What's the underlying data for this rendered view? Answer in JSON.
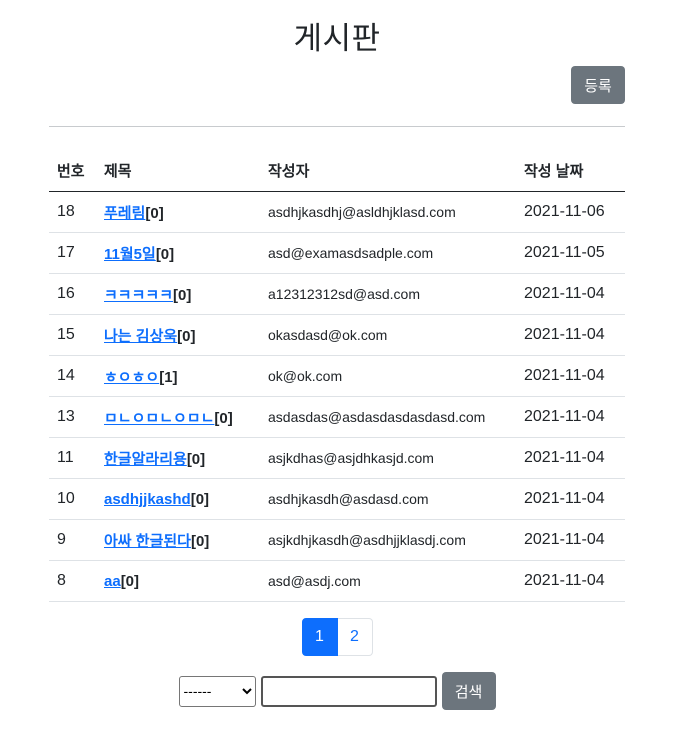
{
  "header": {
    "title": "게시판",
    "register_label": "등록"
  },
  "table": {
    "headers": {
      "no": "번호",
      "title": "제목",
      "author": "작성자",
      "date": "작성 날짜"
    },
    "rows": [
      {
        "no": "18",
        "title": "푸레림",
        "comments": "[0]",
        "author": "asdhjkasdhj@asldhjklasd.com",
        "date": "2021-11-06"
      },
      {
        "no": "17",
        "title": "11월5일",
        "comments": "[0]",
        "author": "asd@examasdsadple.com",
        "date": "2021-11-05"
      },
      {
        "no": "16",
        "title": "ㅋㅋㅋㅋㅋ",
        "comments": "[0]",
        "author": "a12312312sd@asd.com",
        "date": "2021-11-04"
      },
      {
        "no": "15",
        "title": "나는 김상욱",
        "comments": "[0]",
        "author": "okasdasd@ok.com",
        "date": "2021-11-04"
      },
      {
        "no": "14",
        "title": "ㅎㅇㅎㅇ",
        "comments": "[1]",
        "author": "ok@ok.com",
        "date": "2021-11-04"
      },
      {
        "no": "13",
        "title": "ㅁㄴㅇㅁㄴㅇㅁㄴ",
        "comments": "[0]",
        "author": "asdasdas@asdasdasdasdasd.com",
        "date": "2021-11-04"
      },
      {
        "no": "11",
        "title": "한글알라리용",
        "comments": "[0]",
        "author": "asjkdhas@asjdhkasjd.com",
        "date": "2021-11-04"
      },
      {
        "no": "10",
        "title": "asdhjjkashd",
        "comments": "[0]",
        "author": "asdhjkasdh@asdasd.com",
        "date": "2021-11-04"
      },
      {
        "no": "9",
        "title": "아싸 한글된다",
        "comments": "[0]",
        "author": "asjkdhjkasdh@asdhjjklasdj.com",
        "date": "2021-11-04"
      },
      {
        "no": "8",
        "title": "aa",
        "comments": "[0]",
        "author": "asd@asdj.com",
        "date": "2021-11-04"
      }
    ]
  },
  "pagination": {
    "pages": [
      "1",
      "2"
    ],
    "active": "1"
  },
  "search": {
    "select_value": "------",
    "input_value": "",
    "button_label": "검색"
  },
  "colors": {
    "link": "#0d6efd",
    "secondary_button": "#6c757d",
    "active_page": "#0d6efd"
  }
}
